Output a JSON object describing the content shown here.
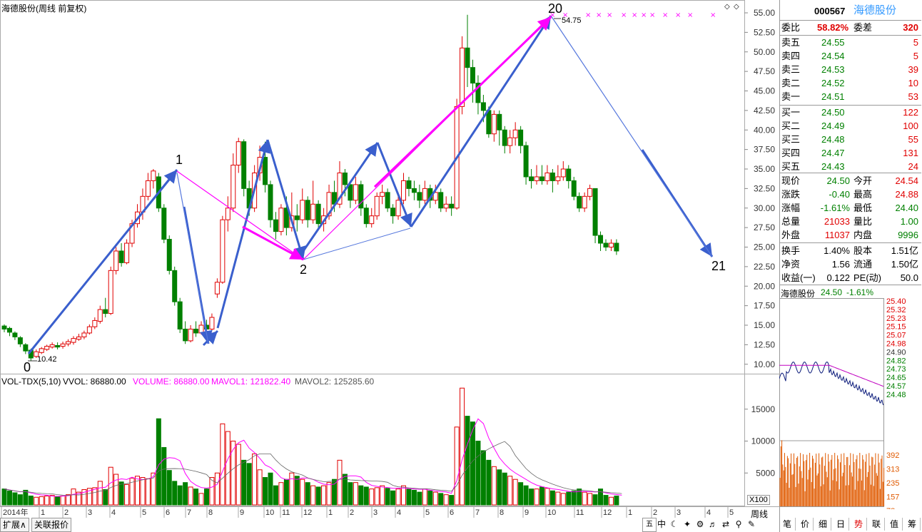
{
  "header": {
    "title": "海德股份(周线 前复权)",
    "vol_title": "VOL-TDX(5,10)",
    "vvol": "VVOL: 86880.00",
    "volume": "VOLUME: 86880.00",
    "mavol1": "MAVOL1: 121822.40",
    "mavol2": "MAVOL2: 125285.60"
  },
  "annotations": {
    "wave_0": "0",
    "wave_1": "1",
    "wave_2": "2",
    "wave_20": "20",
    "wave_21": "21",
    "low_label": "10.42",
    "high_label": "54.75"
  },
  "price_axis": [
    "55.00",
    "52.50",
    "50.00",
    "47.50",
    "45.00",
    "42.50",
    "40.00",
    "37.50",
    "35.00",
    "32.50",
    "30.00",
    "27.50",
    "25.00",
    "22.50",
    "20.00",
    "17.50",
    "15.00",
    "12.50",
    "10.00"
  ],
  "vol_axis": [
    "15000",
    "10000",
    "5000"
  ],
  "vol_scale": "X100",
  "months": [
    "2014年",
    "1",
    "2",
    "3",
    "4",
    "5",
    "6",
    "7",
    "8",
    "9",
    "10",
    "11",
    "12",
    "1",
    "2",
    "3",
    "4",
    "5",
    "6",
    "7",
    "8",
    "9",
    "10",
    "11",
    "12",
    "1",
    "2",
    "3",
    "4",
    "5"
  ],
  "period_label": "周线",
  "quote": {
    "code": "000567",
    "name": "海德股份",
    "weibi_label": "委比",
    "weibi": "58.82%",
    "weicha_label": "委差",
    "weicha": "320",
    "sell": [
      {
        "label": "卖五",
        "price": "24.55",
        "vol": "5"
      },
      {
        "label": "卖四",
        "price": "24.54",
        "vol": "5"
      },
      {
        "label": "卖三",
        "price": "24.53",
        "vol": "39"
      },
      {
        "label": "卖二",
        "price": "24.52",
        "vol": "10"
      },
      {
        "label": "卖一",
        "price": "24.51",
        "vol": "53"
      }
    ],
    "buy": [
      {
        "label": "买一",
        "price": "24.50",
        "vol": "122"
      },
      {
        "label": "买二",
        "price": "24.49",
        "vol": "100"
      },
      {
        "label": "买三",
        "price": "24.48",
        "vol": "55"
      },
      {
        "label": "买四",
        "price": "24.47",
        "vol": "131"
      },
      {
        "label": "买五",
        "price": "24.43",
        "vol": "24"
      }
    ],
    "stats": [
      {
        "l1": "现价",
        "v1": "24.50",
        "l2": "今开",
        "v2": "24.54"
      },
      {
        "l1": "涨跌",
        "v1": "-0.40",
        "l2": "最高",
        "v2": "24.88"
      },
      {
        "l1": "涨幅",
        "v1": "-1.61%",
        "l2": "最低",
        "v2": "24.40"
      },
      {
        "l1": "总量",
        "v1": "21033",
        "l2": "量比",
        "v2": "1.00"
      },
      {
        "l1": "外盘",
        "v1": "11037",
        "l2": "内盘",
        "v2": "9996"
      }
    ],
    "stats2": [
      {
        "l1": "换手",
        "v1": "1.40%",
        "l2": "股本",
        "v2": "1.51亿"
      },
      {
        "l1": "净资",
        "v1": "1.56",
        "l2": "流通",
        "v2": "1.50亿"
      },
      {
        "l1": "收益(一)",
        "v1": "0.122",
        "l2": "PE(动)",
        "v2": "50.0"
      }
    ]
  },
  "mini": {
    "name": "海德股份",
    "price": "24.50",
    "pct": "-1.61%",
    "left_axis": [
      "25.40",
      "25.32",
      "25.23",
      "25.15",
      "25.07",
      "24.98",
      "24.90",
      "24.82",
      "24.73",
      "24.65",
      "24.57",
      "24.48",
      "392",
      "313",
      "235",
      "157",
      "78"
    ]
  },
  "bottom": {
    "tab_expand": "扩展∧",
    "tab_related": "关联报价",
    "tool_icons": [
      "五",
      "中",
      "☾",
      "✦",
      "⚙",
      "♬",
      "⇄",
      "⚲",
      "✎"
    ],
    "right_tabs": [
      "笔",
      "价",
      "细",
      "日",
      "势",
      "联",
      "值",
      "筹"
    ]
  },
  "colors": {
    "up": "#e00000",
    "down": "#008000",
    "arrow_blue": "#3a5fcd",
    "arrow_magenta": "#ff00ff",
    "thin_line": "#5577dd"
  }
}
